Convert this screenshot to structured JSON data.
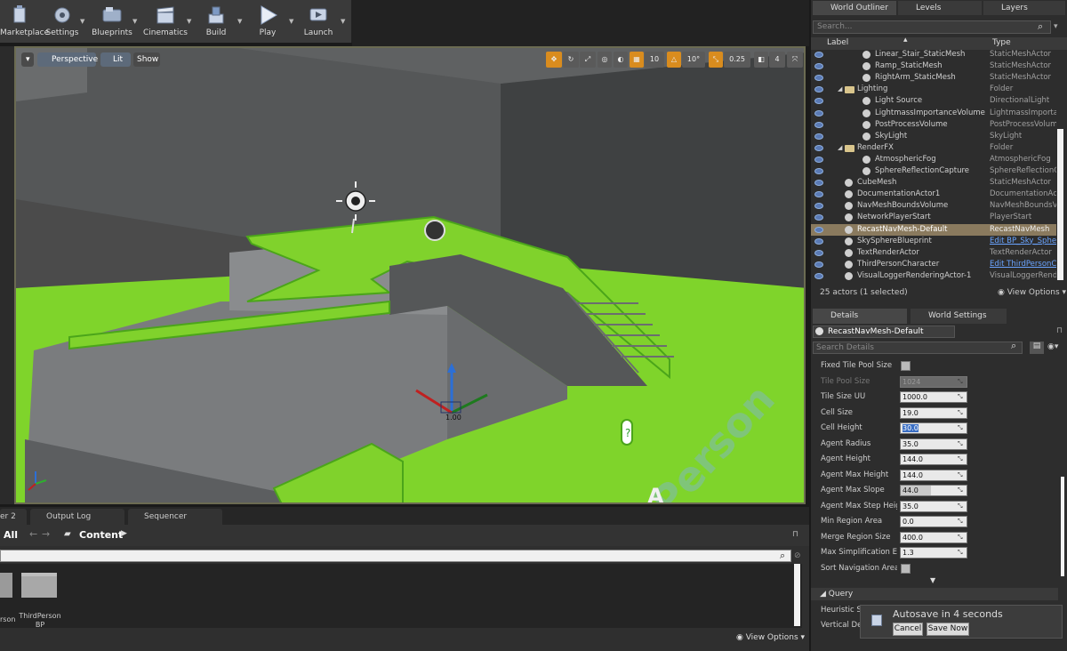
{
  "toolbar": {
    "items": [
      {
        "label": "Marketplace",
        "icon": "marketplace-icon"
      },
      {
        "label": "Settings",
        "icon": "gear-icon"
      },
      {
        "label": "Blueprints",
        "icon": "blueprint-icon"
      },
      {
        "label": "Cinematics",
        "icon": "clapper-icon"
      },
      {
        "label": "Build",
        "icon": "build-icon"
      },
      {
        "label": "Play",
        "icon": "play-icon"
      },
      {
        "label": "Launch",
        "icon": "launch-icon"
      }
    ]
  },
  "viewport": {
    "perspective_label": "Perspective",
    "lit_label": "Lit",
    "show_label": "Show",
    "grid_snap": "10",
    "rotation_snap": "10°",
    "scale_snap": "0.25",
    "camera_speed": "4",
    "scene_text": "Person",
    "gizmo_label": "1.00"
  },
  "bottom_tabs": [
    {
      "label": "er 2"
    },
    {
      "label": "Output Log"
    },
    {
      "label": "Sequencer"
    }
  ],
  "content_browser": {
    "all_label": "All",
    "path_label": "Content",
    "assets": [
      {
        "label": "rson"
      },
      {
        "label": "ThirdPerson BP"
      }
    ],
    "view_options": "View Options"
  },
  "outliner": {
    "tabs": [
      {
        "label": "World Outliner"
      },
      {
        "label": "Levels"
      },
      {
        "label": "Layers"
      }
    ],
    "search_placeholder": "Search...",
    "col_label": "Label",
    "col_type": "Type",
    "rows": [
      {
        "label": "Linear_Stair_StaticMesh",
        "type": "StaticMeshActor",
        "indent": 2,
        "icon": "mesh"
      },
      {
        "label": "Ramp_StaticMesh",
        "type": "StaticMeshActor",
        "indent": 2,
        "icon": "mesh"
      },
      {
        "label": "RightArm_StaticMesh",
        "type": "StaticMeshActor",
        "indent": 2,
        "icon": "mesh"
      },
      {
        "label": "Lighting",
        "type": "Folder",
        "indent": 1,
        "icon": "folder"
      },
      {
        "label": "Light Source",
        "type": "DirectionalLight",
        "indent": 2,
        "icon": "light"
      },
      {
        "label": "LightmassImportanceVolume",
        "type": "LightmassImportar",
        "indent": 2,
        "icon": "light"
      },
      {
        "label": "PostProcessVolume",
        "type": "PostProcessVolume",
        "indent": 2,
        "icon": "volume"
      },
      {
        "label": "SkyLight",
        "type": "SkyLight",
        "indent": 2,
        "icon": "light"
      },
      {
        "label": "RenderFX",
        "type": "Folder",
        "indent": 1,
        "icon": "folder"
      },
      {
        "label": "AtmosphericFog",
        "type": "AtmosphericFog",
        "indent": 2,
        "icon": "fog"
      },
      {
        "label": "SphereReflectionCapture",
        "type": "SphereReflectionCa",
        "indent": 2,
        "icon": "sphere"
      },
      {
        "label": "CubeMesh",
        "type": "StaticMeshActor",
        "indent": 1,
        "icon": "mesh"
      },
      {
        "label": "DocumentationActor1",
        "type": "DocumentationAct",
        "indent": 1,
        "icon": "doc"
      },
      {
        "label": "NavMeshBoundsVolume",
        "type": "NavMeshBoundsVo",
        "indent": 1,
        "icon": "volume"
      },
      {
        "label": "NetworkPlayerStart",
        "type": "PlayerStart",
        "indent": 1,
        "icon": "player"
      },
      {
        "label": "RecastNavMesh-Default",
        "type": "RecastNavMesh",
        "indent": 1,
        "icon": "sphere",
        "selected": true
      },
      {
        "label": "SkySphereBlueprint",
        "type": "Edit BP_Sky_Sphe",
        "indent": 1,
        "icon": "sphere",
        "link": true
      },
      {
        "label": "TextRenderActor",
        "type": "TextRenderActor",
        "indent": 1,
        "icon": "text"
      },
      {
        "label": "ThirdPersonCharacter",
        "type": "Edit ThirdPersonC",
        "indent": 1,
        "icon": "player",
        "link": true
      },
      {
        "label": "VisualLoggerRenderingActor-1",
        "type": "VisualLoggerRende",
        "indent": 1,
        "icon": "sphere"
      }
    ],
    "footer_count": "25 actors (1 selected)",
    "view_options": "View Options"
  },
  "details": {
    "tabs": [
      {
        "label": "Details"
      },
      {
        "label": "World Settings"
      }
    ],
    "selected_actor": "RecastNavMesh-Default",
    "search_placeholder": "Search Details",
    "properties": [
      {
        "label": "Fixed Tile Pool Size",
        "kind": "check"
      },
      {
        "label": "Tile Pool Size",
        "value": "1024",
        "disabled": true
      },
      {
        "label": "Tile Size UU",
        "value": "1000.0"
      },
      {
        "label": "Cell Size",
        "value": "19.0"
      },
      {
        "label": "Cell Height",
        "value": "30.0"
      },
      {
        "label": "Agent Radius",
        "value": "35.0"
      },
      {
        "label": "Agent Height",
        "value": "144.0"
      },
      {
        "label": "Agent Max Height",
        "value": "144.0"
      },
      {
        "label": "Agent Max Slope",
        "value": "44.0",
        "slider": 0.46
      },
      {
        "label": "Agent Max Step Height",
        "value": "35.0"
      },
      {
        "label": "Min Region Area",
        "value": "0.0"
      },
      {
        "label": "Merge Region Size",
        "value": "400.0"
      },
      {
        "label": "Max Simplification Erro",
        "value": "1.3"
      },
      {
        "label": "Sort Navigation Areas b",
        "kind": "check"
      }
    ],
    "query_header": "Query",
    "query_rows": [
      {
        "label": "Heuristic Sc"
      },
      {
        "label": "Vertical Dev"
      }
    ]
  },
  "autosave": {
    "message": "Autosave in 4 seconds",
    "cancel_label": "Cancel",
    "save_now_label": "Save Now"
  },
  "colors": {
    "navmesh_green": "#7fd42b",
    "selection": "#8a7a5e",
    "link": "#6aa4ff"
  }
}
